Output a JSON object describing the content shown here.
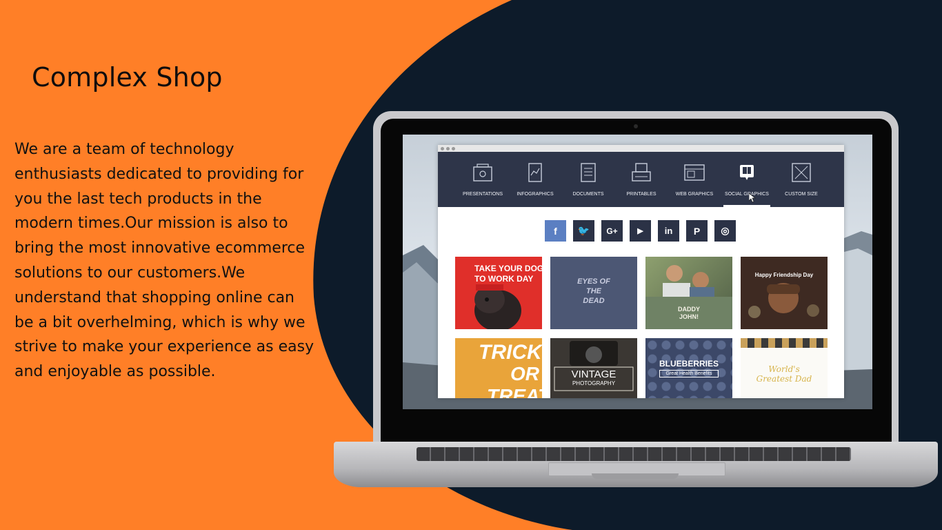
{
  "page": {
    "title": "Complex Shop",
    "description": "We are a team of technology enthusiasts dedicated to providing for you the last tech products in the modern times.Our mission is also to bring the most innovative ecommerce solutions to our customers.We understand that shopping online can be a bit overhelming, which is why we strive to make your experience as easy and enjoyable as possible."
  },
  "colors": {
    "orange": "#ff7f27",
    "navy": "#0d1b2a",
    "app_nav": "#2e3549",
    "facebook": "#5b7fc2"
  },
  "app": {
    "categories": [
      {
        "label": "PRESENTATIONS",
        "icon": "presentation-icon"
      },
      {
        "label": "INFOGRAPHICS",
        "icon": "infographic-icon"
      },
      {
        "label": "DOCUMENTS",
        "icon": "document-icon"
      },
      {
        "label": "PRINTABLES",
        "icon": "printer-icon"
      },
      {
        "label": "WEB GRAPHICS",
        "icon": "web-graphics-icon"
      },
      {
        "label": "SOCIAL GRAPHICS",
        "icon": "social-graphics-icon",
        "active": true
      },
      {
        "label": "CUSTOM SIZE",
        "icon": "custom-size-icon"
      }
    ],
    "social": [
      {
        "glyph": "f",
        "icon": "facebook-icon"
      },
      {
        "glyph": "🐦",
        "icon": "twitter-icon"
      },
      {
        "glyph": "G+",
        "icon": "google-plus-icon"
      },
      {
        "glyph": "▶",
        "icon": "youtube-icon"
      },
      {
        "glyph": "in",
        "icon": "linkedin-icon"
      },
      {
        "glyph": "P",
        "icon": "pinterest-icon"
      },
      {
        "glyph": "◎",
        "icon": "instagram-icon"
      }
    ],
    "templates": [
      {
        "name": "dog-template",
        "lines": [
          "TAKE YOUR DOG",
          "TO WORK DAY"
        ]
      },
      {
        "name": "eyes-of-the-dead-template",
        "lines": [
          "EYES OF",
          "THE",
          "DEAD"
        ]
      },
      {
        "name": "daddy-john-template",
        "lines": [
          "DADDY",
          "JOHN!"
        ]
      },
      {
        "name": "friendship-day-template",
        "lines": [
          "Happy Friendship Day"
        ]
      },
      {
        "name": "trick-or-treat-template",
        "lines": [
          "TRICK",
          "OR",
          "TREAT"
        ]
      },
      {
        "name": "vintage-photography-template",
        "lines": [
          "VINTAGE",
          "PHOTOGRAPHY"
        ]
      },
      {
        "name": "blueberries-template",
        "lines": [
          "BLUEBERRIES",
          "Great Health Benefits"
        ]
      },
      {
        "name": "worlds-greatest-dad-template",
        "lines": [
          "World's",
          "Greatest Dad"
        ]
      }
    ]
  }
}
